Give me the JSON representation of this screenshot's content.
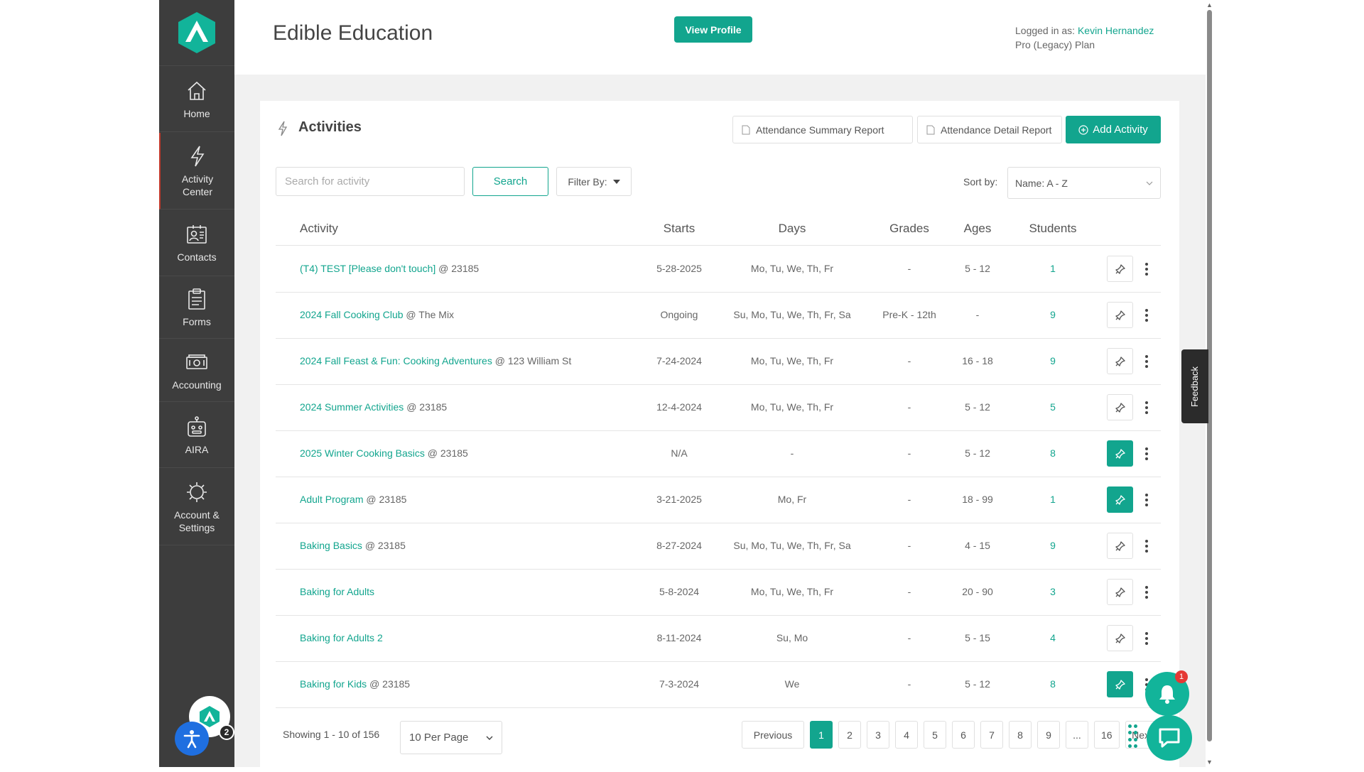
{
  "header": {
    "title": "Edible Education",
    "view_profile": "View Profile",
    "logged_in_label": "Logged in as:",
    "user_name": "Kevin Hernandez",
    "plan": "Pro (Legacy) Plan"
  },
  "sidebar": {
    "items": [
      {
        "label": "Home",
        "icon": "home-icon"
      },
      {
        "label": "Activity Center",
        "icon": "bolt-icon"
      },
      {
        "label": "Contacts",
        "icon": "contacts-icon"
      },
      {
        "label": "Forms",
        "icon": "clipboard-icon"
      },
      {
        "label": "Accounting",
        "icon": "money-icon"
      },
      {
        "label": "AIRA",
        "icon": "robot-icon"
      },
      {
        "label": "Account & Settings",
        "icon": "gear-icon"
      }
    ],
    "badge_count": "2"
  },
  "card": {
    "title": "Activities",
    "btn_summary": "Attendance Summary Report",
    "btn_detail": "Attendance Detail Report",
    "btn_add": "Add Activity",
    "search_placeholder": "Search for activity",
    "search_btn": "Search",
    "filter_btn": "Filter By:",
    "sort_label": "Sort by:",
    "sort_value": "Name: A - Z"
  },
  "table": {
    "headers": [
      "Activity",
      "Starts",
      "Days",
      "Grades",
      "Ages",
      "Students"
    ],
    "rows": [
      {
        "name": "(T4) TEST [Please don't touch]",
        "loc": "@ 23185",
        "starts": "5-28-2025",
        "days": "Mo, Tu, We, Th, Fr",
        "grades": "-",
        "ages": "5 - 12",
        "students": "1",
        "pinned": false
      },
      {
        "name": "2024 Fall Cooking Club",
        "loc": "@ The Mix",
        "starts": "Ongoing",
        "days": "Su, Mo, Tu, We, Th, Fr, Sa",
        "grades": "Pre-K - 12th",
        "ages": "-",
        "students": "9",
        "pinned": false
      },
      {
        "name": "2024 Fall Feast & Fun: Cooking Adventures",
        "loc": "@ 123 William St",
        "starts": "7-24-2024",
        "days": "Mo, Tu, We, Th, Fr",
        "grades": "-",
        "ages": "16 - 18",
        "students": "9",
        "pinned": false
      },
      {
        "name": "2024 Summer Activities",
        "loc": "@ 23185",
        "starts": "12-4-2024",
        "days": "Mo, Tu, We, Th, Fr",
        "grades": "-",
        "ages": "5 - 12",
        "students": "5",
        "pinned": false
      },
      {
        "name": "2025 Winter Cooking Basics",
        "loc": "@ 23185",
        "starts": "N/A",
        "days": "-",
        "grades": "-",
        "ages": "5 - 12",
        "students": "8",
        "pinned": true
      },
      {
        "name": "Adult Program",
        "loc": "@ 23185",
        "starts": "3-21-2025",
        "days": "Mo, Fr",
        "grades": "-",
        "ages": "18 - 99",
        "students": "1",
        "pinned": true
      },
      {
        "name": "Baking Basics",
        "loc": "@ 23185",
        "starts": "8-27-2024",
        "days": "Su, Mo, Tu, We, Th, Fr, Sa",
        "grades": "-",
        "ages": "4 - 15",
        "students": "9",
        "pinned": false
      },
      {
        "name": "Baking for Adults",
        "loc": "",
        "starts": "5-8-2024",
        "days": "Mo, Tu, We, Th, Fr",
        "grades": "-",
        "ages": "20 - 90",
        "students": "3",
        "pinned": false
      },
      {
        "name": "Baking for Adults 2",
        "loc": "",
        "starts": "8-11-2024",
        "days": "Su, Mo",
        "grades": "-",
        "ages": "5 - 15",
        "students": "4",
        "pinned": false
      },
      {
        "name": "Baking for Kids",
        "loc": "@ 23185",
        "starts": "7-3-2024",
        "days": "We",
        "grades": "-",
        "ages": "5 - 12",
        "students": "8",
        "pinned": true
      }
    ]
  },
  "footer": {
    "showing": "Showing 1 - 10 of 156",
    "per_page": "10 Per Page",
    "previous": "Previous",
    "pages": [
      "1",
      "2",
      "3",
      "4",
      "5",
      "6",
      "7",
      "8",
      "9",
      "...",
      "16"
    ],
    "active_page": "1",
    "next_partial": "Nex"
  },
  "floating": {
    "feedback": "Feedback",
    "bell_badge": "1"
  },
  "colors": {
    "accent": "#12a58e",
    "sidebar_bg": "#3d3d3d"
  }
}
